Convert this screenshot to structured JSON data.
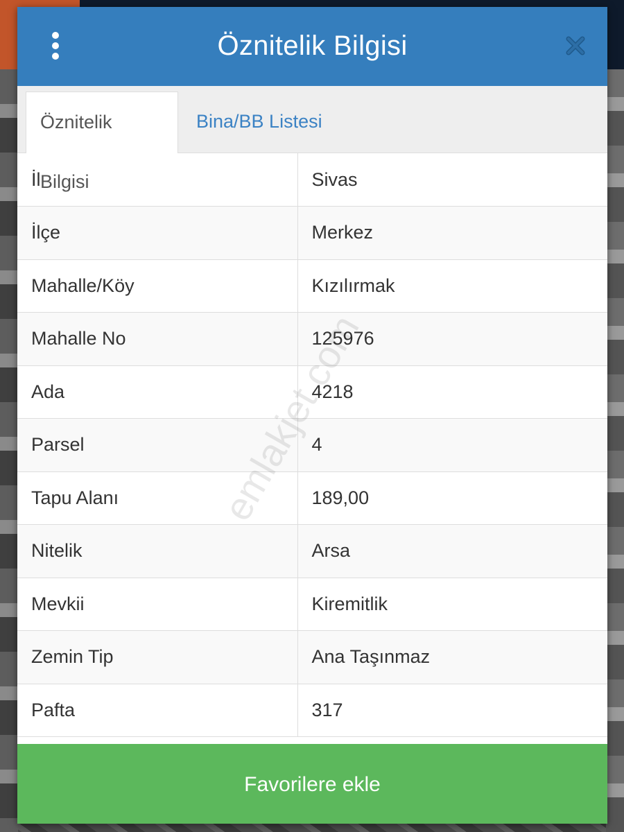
{
  "dialog": {
    "title": "Öznitelik Bilgisi",
    "header_color": "#357ebd"
  },
  "tabs": [
    {
      "label": "Öznitelik Bilgisi",
      "active": true
    },
    {
      "label": "Bina/BB Listesi",
      "active": false
    }
  ],
  "attributes": [
    {
      "key": "İl",
      "value": "Sivas"
    },
    {
      "key": "İlçe",
      "value": "Merkez"
    },
    {
      "key": "Mahalle/Köy",
      "value": "Kızılırmak"
    },
    {
      "key": "Mahalle No",
      "value": "125976"
    },
    {
      "key": "Ada",
      "value": "4218"
    },
    {
      "key": "Parsel",
      "value": "4"
    },
    {
      "key": "Tapu Alanı",
      "value": "189,00"
    },
    {
      "key": "Nitelik",
      "value": "Arsa"
    },
    {
      "key": "Mevkii",
      "value": "Kiremitlik"
    },
    {
      "key": "Zemin Tip",
      "value": "Ana Taşınmaz"
    },
    {
      "key": "Pafta",
      "value": "317"
    }
  ],
  "footer": {
    "favorite_label": "Favorilere ekle",
    "button_color": "#5cb85c"
  },
  "watermark": "emlakjet.com",
  "icons": {
    "menu": "kebab-menu-icon",
    "close": "close-icon"
  }
}
